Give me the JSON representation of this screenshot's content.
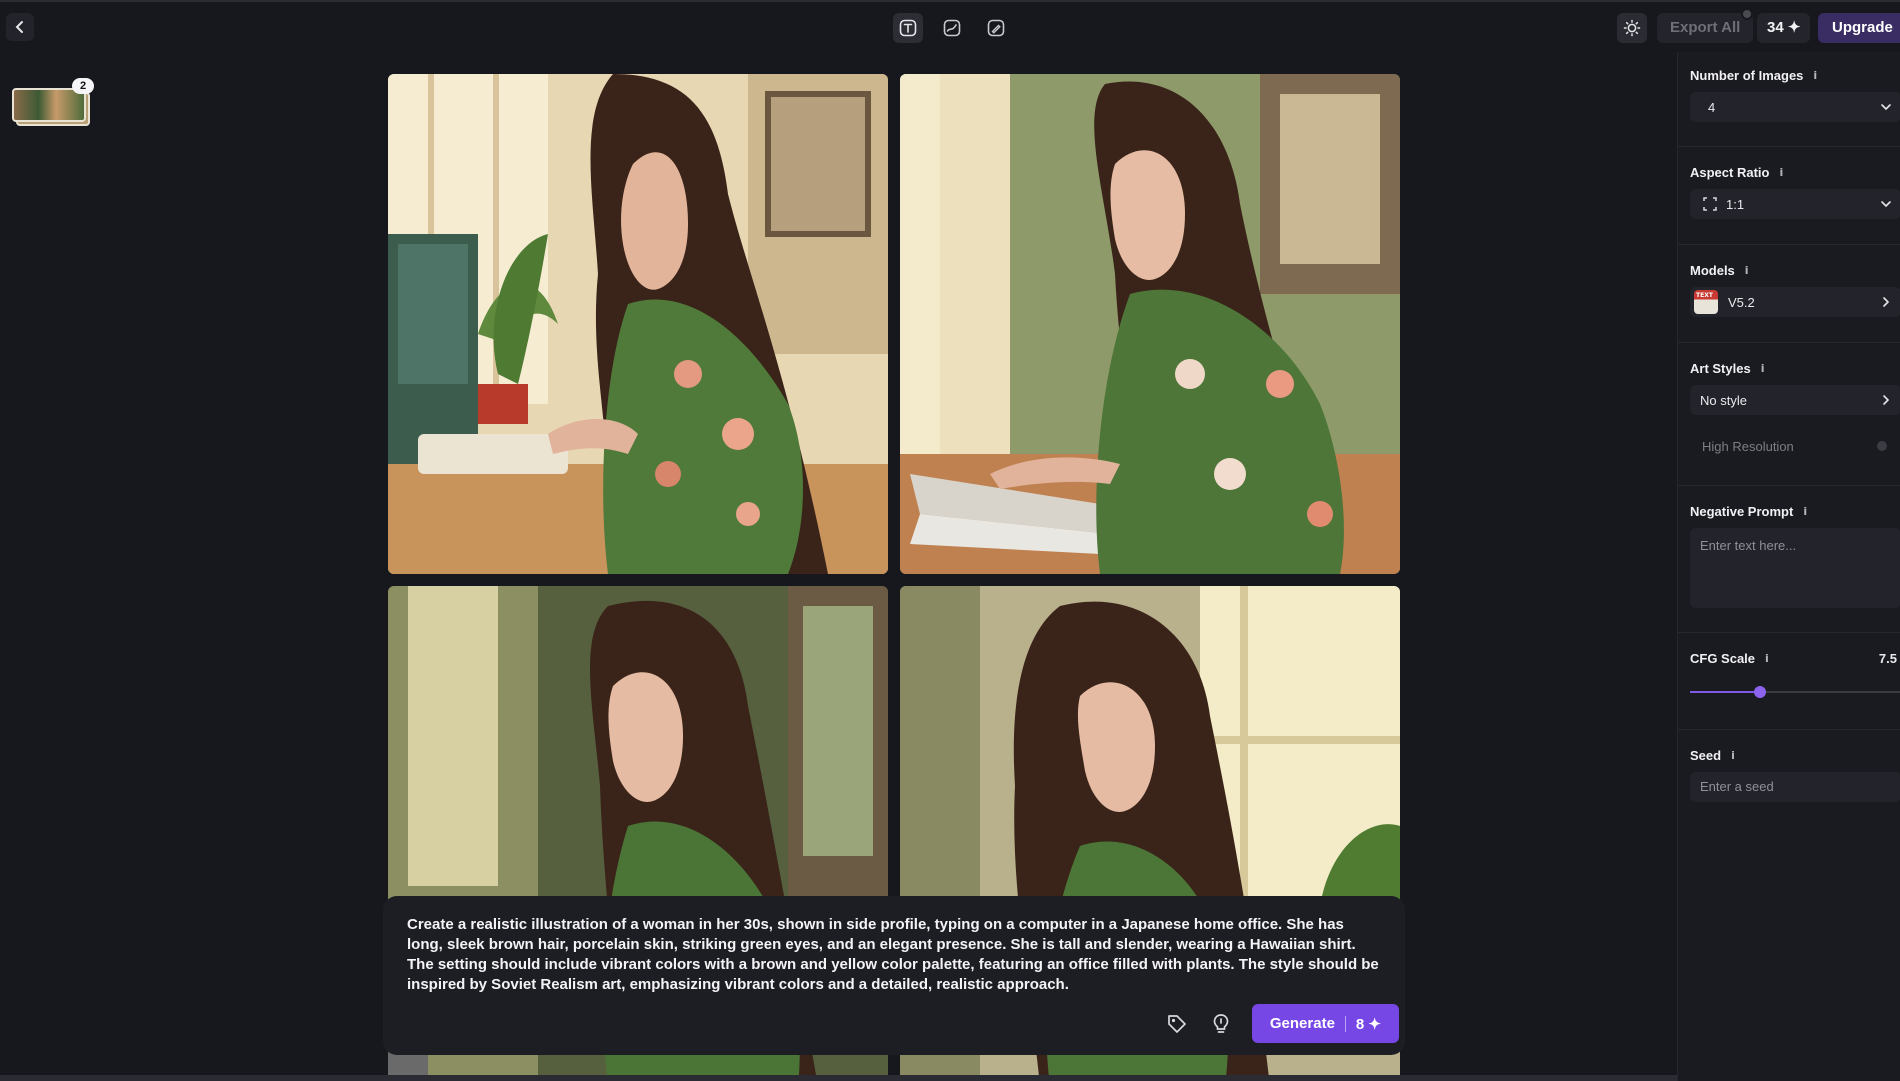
{
  "topbar": {
    "export_label": "Export All",
    "credits_label": "34 ✦",
    "upgrade_label": "Upgrade"
  },
  "history": {
    "badge": "2"
  },
  "prompt": {
    "text": "Create a realistic illustration of a woman in her 30s, shown in side profile, typing on a computer in a Japanese home office. She has long, sleek brown hair, porcelain skin, striking green eyes, and an elegant presence. She is tall and slender, wearing a Hawaiian shirt. The setting should include vibrant colors with a brown and yellow color palette, featuring an office filled with plants. The style should be inspired by Soviet Realism art, emphasizing vibrant colors and a detailed, realistic approach.",
    "generate_label": "Generate",
    "generate_cost": "8 ✦"
  },
  "sidebar": {
    "num_images": {
      "label": "Number of Images",
      "value": "4"
    },
    "aspect_ratio": {
      "label": "Aspect Ratio",
      "value": "1:1"
    },
    "models": {
      "label": "Models",
      "value": "V5.2",
      "thumb_text": "TEXT"
    },
    "art_styles": {
      "label": "Art Styles",
      "value": "No style"
    },
    "high_res": {
      "label": "High Resolution"
    },
    "negative_prompt": {
      "label": "Negative Prompt",
      "placeholder": "Enter text here..."
    },
    "cfg_scale": {
      "label": "CFG Scale",
      "value": "7.5",
      "fraction": 0.33
    },
    "seed": {
      "label": "Seed",
      "placeholder": "Enter a seed"
    },
    "info_glyph": "i"
  },
  "colors": {
    "accent": "#7747e6",
    "upgrade_bg": "#3a2d63",
    "background": "#17181d",
    "panel": "#1d1e24"
  },
  "icons": {
    "back": "chevron-left-icon",
    "text_mode": "text-mode-icon",
    "sketch_mode": "sketch-mode-icon",
    "edit_mode": "edit-mode-icon",
    "theme": "sun-icon",
    "tag": "tag-icon",
    "idea": "lightbulb-icon",
    "dropdown": "chevron-down-icon",
    "next": "chevron-right-icon",
    "aspect": "aspect-frame-icon"
  }
}
